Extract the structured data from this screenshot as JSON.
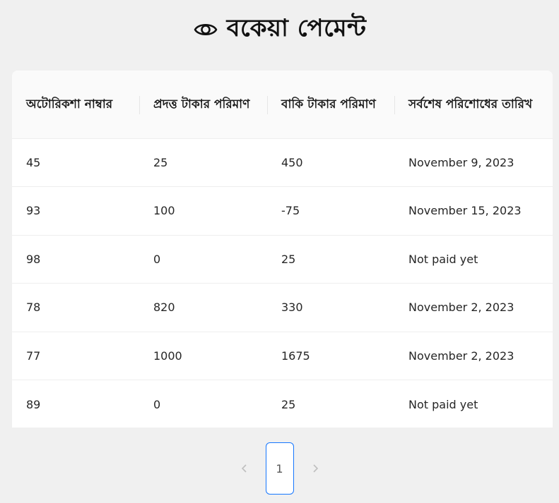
{
  "header": {
    "title": "বকেয়া পেমেন্ট",
    "icon": "eye-icon"
  },
  "table": {
    "columns": [
      "অটোরিকশা নাম্বার",
      "প্রদত্ত টাকার পরিমাণ",
      "বাকি টাকার পরিমাণ",
      "সর্বশেষ পরিশোধের তারিখ"
    ],
    "rows": [
      [
        "45",
        "25",
        "450",
        "November 9, 2023"
      ],
      [
        "93",
        "100",
        "-75",
        "November 15, 2023"
      ],
      [
        "98",
        "0",
        "25",
        "Not paid yet"
      ],
      [
        "78",
        "820",
        "330",
        "November 2, 2023"
      ],
      [
        "77",
        "1000",
        "1675",
        "November 2, 2023"
      ],
      [
        "89",
        "0",
        "25",
        "Not paid yet"
      ]
    ]
  },
  "pagination": {
    "prev_icon": "chevron-left-icon",
    "next_icon": "chevron-right-icon",
    "current_page": "1"
  },
  "colors": {
    "background": "#f0f0f0",
    "accent": "#1677ff",
    "header_row": "#fafafa"
  }
}
